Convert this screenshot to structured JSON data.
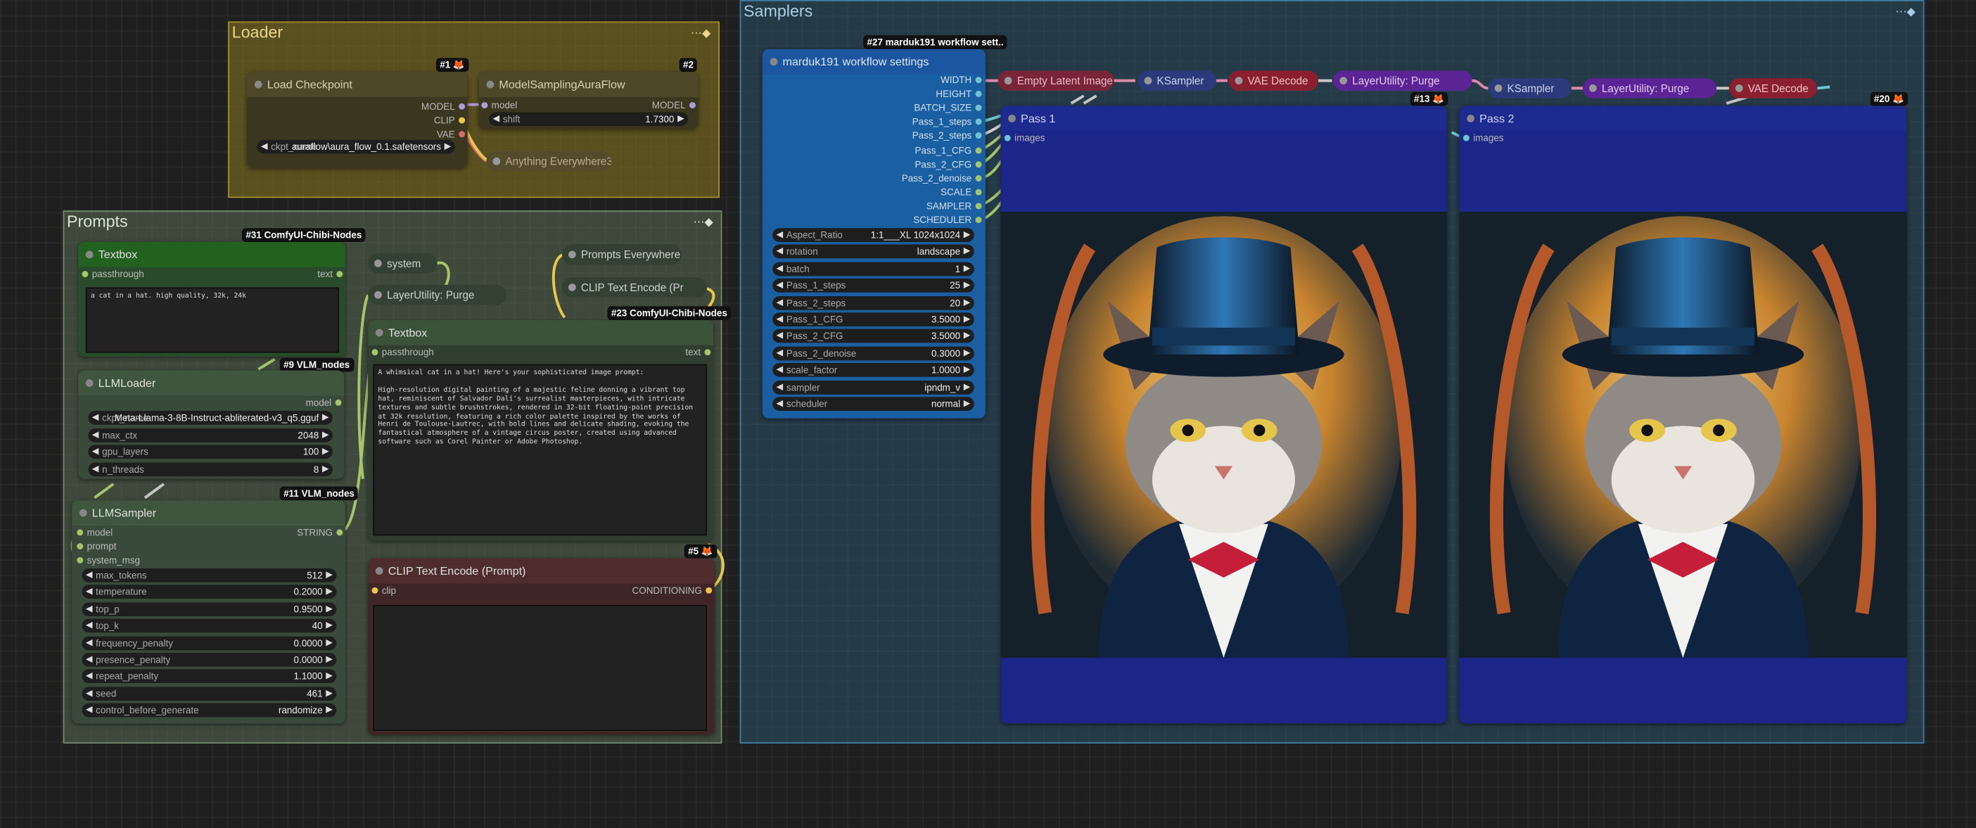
{
  "groups": {
    "loader": {
      "title": "Loader"
    },
    "prompts": {
      "title": "Prompts"
    },
    "samplers": {
      "title": "Samplers"
    }
  },
  "badges": {
    "n1": "#1 🦊",
    "n2": "#2",
    "n31": "#31 ComfyUI-Chibi-Nodes",
    "n9": "#9 VLM_nodes",
    "n11": "#11 VLM_nodes",
    "n23": "#23 ComfyUI-Chibi-Nodes",
    "n5": "#5 🦊",
    "n27": "#27 marduk191 workflow sett..",
    "n13": "#13 🦊",
    "n20": "#20 🦊"
  },
  "load_checkpoint": {
    "title": "Load Checkpoint",
    "outputs": [
      "MODEL",
      "CLIP",
      "VAE"
    ],
    "ckpt_label": "ckpt_name",
    "ckpt_value": "auraflow\\aura_flow_0.1.safetensors"
  },
  "model_sampling": {
    "title": "ModelSamplingAuraFlow",
    "input": "model",
    "output": "MODEL",
    "shift_label": "shift",
    "shift_value": "1.7300"
  },
  "anything_everywhere": {
    "title": "Anything Everywhere3"
  },
  "textbox1": {
    "title": "Textbox",
    "input": "passthrough",
    "output": "text",
    "text": "a cat in a hat. high quality, 32k, 24k"
  },
  "llm_loader": {
    "title": "LLMLoader",
    "output": "model",
    "widgets": [
      {
        "label": "ckpt_name",
        "value": "Meta-Llama-3-8B-Instruct-abliterated-v3_q5.gguf"
      },
      {
        "label": "max_ctx",
        "value": "2048"
      },
      {
        "label": "gpu_layers",
        "value": "100"
      },
      {
        "label": "n_threads",
        "value": "8"
      }
    ]
  },
  "llm_sampler": {
    "title": "LLMSampler",
    "inputs": [
      "model",
      "prompt",
      "system_msg"
    ],
    "output": "STRING",
    "widgets": [
      {
        "label": "max_tokens",
        "value": "512"
      },
      {
        "label": "temperature",
        "value": "0.2000"
      },
      {
        "label": "top_p",
        "value": "0.9500"
      },
      {
        "label": "top_k",
        "value": "40"
      },
      {
        "label": "frequency_penalty",
        "value": "0.0000"
      },
      {
        "label": "presence_penalty",
        "value": "0.0000"
      },
      {
        "label": "repeat_penalty",
        "value": "1.1000"
      },
      {
        "label": "seed",
        "value": "461"
      },
      {
        "label": "control_before_generate",
        "value": "randomize"
      }
    ]
  },
  "system_node": {
    "title": "system"
  },
  "layer_purge_prompts": {
    "title": "LayerUtility: Purge"
  },
  "prompts_everywhere": {
    "title": "Prompts Everywhere"
  },
  "clip_encode_small": {
    "title": "CLIP Text Encode (Pr"
  },
  "textbox2": {
    "title": "Textbox",
    "input": "passthrough",
    "output": "text",
    "text": "A whimsical cat in a hat! Here's your sophisticated image prompt:\n\nHigh-resolution digital painting of a majestic feline donning a vibrant top hat, reminiscent of Salvador Dalí's surrealist masterpieces, with intricate textures and subtle brushstrokes, rendered in 32-bit floating-point precision at 32k resolution, featuring a rich color palette inspired by the works of Henri de Toulouse-Lautrec, with bold lines and delicate shading, evoking the fantastical atmosphere of a vintage circus poster, created using advanced software such as Corel Painter or Adobe Photoshop."
  },
  "clip_encode": {
    "title": "CLIP Text Encode (Prompt)",
    "input": "clip",
    "output": "CONDITIONING"
  },
  "settings": {
    "title": "marduk191 workflow settings",
    "outputs": [
      "WIDTH",
      "HEIGHT",
      "BATCH_SIZE",
      "Pass_1_steps",
      "Pass_2_steps",
      "Pass_1_CFG",
      "Pass_2_CFG",
      "Pass_2_denoise",
      "SCALE",
      "SAMPLER",
      "SCHEDULER"
    ],
    "widgets": [
      {
        "label": "Aspect_Ratio",
        "value": "1:1___XL 1024x1024"
      },
      {
        "label": "rotation",
        "value": "landscape"
      },
      {
        "label": "batch",
        "value": "1"
      },
      {
        "label": "Pass_1_steps",
        "value": "25"
      },
      {
        "label": "Pass_2_steps",
        "value": "20"
      },
      {
        "label": "Pass_1_CFG",
        "value": "3.5000"
      },
      {
        "label": "Pass_2_CFG",
        "value": "3.5000"
      },
      {
        "label": "Pass_2_denoise",
        "value": "0.3000"
      },
      {
        "label": "scale_factor",
        "value": "1.0000"
      },
      {
        "label": "sampler",
        "value": "ipndm_v"
      },
      {
        "label": "scheduler",
        "value": "normal"
      }
    ]
  },
  "chain": [
    {
      "title": "Empty Latent Image"
    },
    {
      "title": "KSampler"
    },
    {
      "title": "VAE Decode"
    },
    {
      "title": "LayerUtility: Purge"
    },
    {
      "title": "KSampler"
    },
    {
      "title": "LayerUtility: Purge"
    },
    {
      "title": "VAE Decode"
    }
  ],
  "pass1": {
    "title": "Pass 1",
    "input": "images"
  },
  "pass2": {
    "title": "Pass 2",
    "input": "images"
  },
  "colors": {
    "loader_group": "#88761f",
    "prompts_group": "#5d7358",
    "samplers_group": "#2d5a78",
    "settings_node": "#1b5fa3",
    "preview_node": "#1c2588"
  },
  "icons": {
    "group_menu": "⋯◆",
    "fox": "🦊"
  }
}
